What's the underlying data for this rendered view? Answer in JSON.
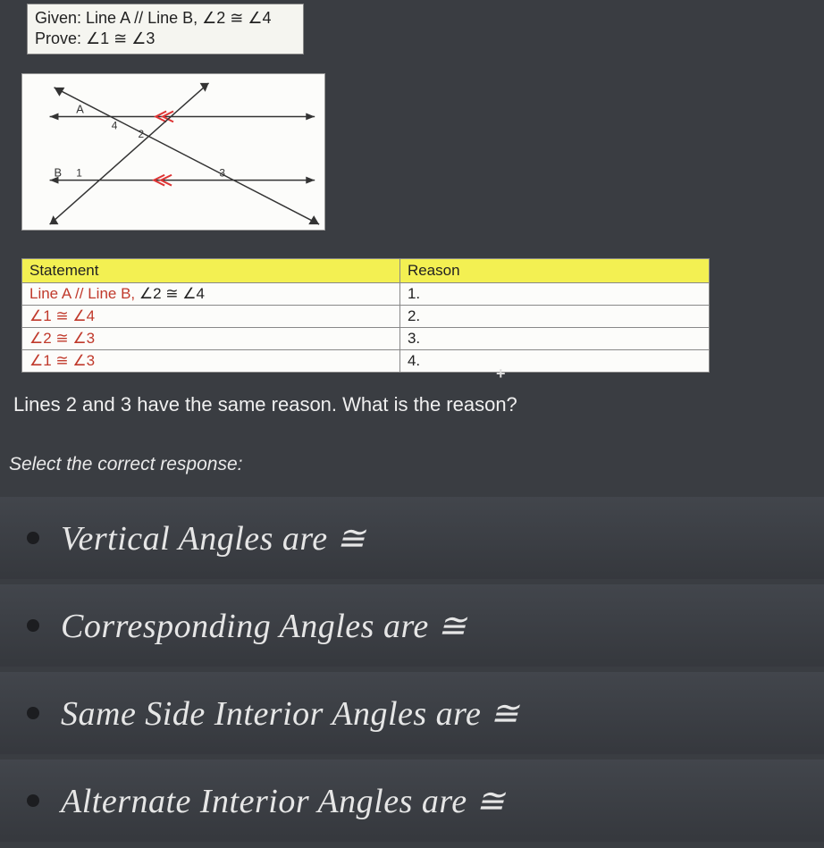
{
  "given": {
    "line1": "Given: Line A // Line B,  ∠2 ≅ ∠4",
    "line2": "Prove: ∠1 ≅ ∠3"
  },
  "diagram": {
    "labelA": "A",
    "labelB": "B",
    "angle1": "1",
    "angle2": "2",
    "angle3": "3",
    "angle4": "4"
  },
  "table": {
    "headers": {
      "statement": "Statement",
      "reason": "Reason"
    },
    "rows": [
      {
        "statement": "Line A // Line B, ∠2 ≅ ∠4",
        "reason": "1."
      },
      {
        "statement": "∠1 ≅ ∠4",
        "reason": "2."
      },
      {
        "statement": "∠2 ≅ ∠3",
        "reason": "3."
      },
      {
        "statement": "∠1 ≅ ∠3",
        "reason": "4."
      }
    ]
  },
  "question": "Lines 2 and 3 have the same reason.  What is the reason?",
  "prompt": "Select the correct response:",
  "options": [
    "Vertical Angles are  ≅",
    "Corresponding Angles are  ≅",
    "Same Side Interior Angles are  ≅",
    "Alternate Interior Angles are  ≅"
  ]
}
